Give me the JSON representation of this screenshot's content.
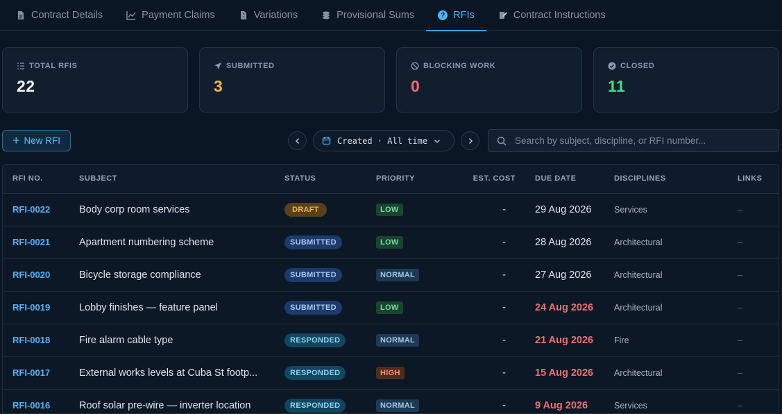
{
  "tabs": [
    {
      "label": "Contract Details",
      "icon": "document-icon",
      "active": false
    },
    {
      "label": "Payment Claims",
      "icon": "chart-line-icon",
      "active": false
    },
    {
      "label": "Variations",
      "icon": "file-diff-icon",
      "active": false
    },
    {
      "label": "Provisional Sums",
      "icon": "coins-icon",
      "active": false
    },
    {
      "label": "RFIs",
      "icon": "question-icon",
      "active": true
    },
    {
      "label": "Contract Instructions",
      "icon": "edit-document-icon",
      "active": false
    }
  ],
  "stats": [
    {
      "label": "TOTAL RFIS",
      "value": "22",
      "icon": "list-icon",
      "color": "#eef2f7"
    },
    {
      "label": "SUBMITTED",
      "value": "3",
      "icon": "send-icon",
      "color": "#f2b440"
    },
    {
      "label": "BLOCKING WORK",
      "value": "0",
      "icon": "blocked-icon",
      "color": "#f06b76"
    },
    {
      "label": "CLOSED",
      "value": "11",
      "icon": "check-circle-icon",
      "color": "#4fd88a"
    }
  ],
  "toolbar": {
    "new_label": "New RFI",
    "date_filter": "Created · All time",
    "search_placeholder": "Search by subject, discipline, or RFI number..."
  },
  "table": {
    "columns": [
      "RFI NO.",
      "SUBJECT",
      "STATUS",
      "PRIORITY",
      "EST. COST",
      "DUE DATE",
      "DISCIPLINES",
      "LINKS"
    ],
    "rows": [
      {
        "no": "RFI-0022",
        "subject": "Body corp room services",
        "status": "DRAFT",
        "priority": "LOW",
        "cost": "-",
        "due": "29 Aug 2026",
        "overdue": false,
        "discipline": "Services",
        "links": "–"
      },
      {
        "no": "RFI-0021",
        "subject": "Apartment numbering scheme",
        "status": "SUBMITTED",
        "priority": "LOW",
        "cost": "-",
        "due": "28 Aug 2026",
        "overdue": false,
        "discipline": "Architectural",
        "links": "–"
      },
      {
        "no": "RFI-0020",
        "subject": "Bicycle storage compliance",
        "status": "SUBMITTED",
        "priority": "NORMAL",
        "cost": "-",
        "due": "27 Aug 2026",
        "overdue": false,
        "discipline": "Architectural",
        "links": "–"
      },
      {
        "no": "RFI-0019",
        "subject": "Lobby finishes — feature panel",
        "status": "SUBMITTED",
        "priority": "LOW",
        "cost": "-",
        "due": "24 Aug 2026",
        "overdue": true,
        "discipline": "Architectural",
        "links": "–"
      },
      {
        "no": "RFI-0018",
        "subject": "Fire alarm cable type",
        "status": "RESPONDED",
        "priority": "NORMAL",
        "cost": "-",
        "due": "21 Aug 2026",
        "overdue": true,
        "discipline": "Fire",
        "links": "–"
      },
      {
        "no": "RFI-0017",
        "subject": "External works levels at Cuba St footp...",
        "status": "RESPONDED",
        "priority": "HIGH",
        "cost": "-",
        "due": "15 Aug 2026",
        "overdue": true,
        "discipline": "Architectural",
        "links": "–"
      },
      {
        "no": "RFI-0016",
        "subject": "Roof solar pre-wire — inverter location",
        "status": "RESPONDED",
        "priority": "NORMAL",
        "cost": "-",
        "due": "9 Aug 2026",
        "overdue": true,
        "discipline": "Services",
        "links": "–"
      }
    ]
  }
}
